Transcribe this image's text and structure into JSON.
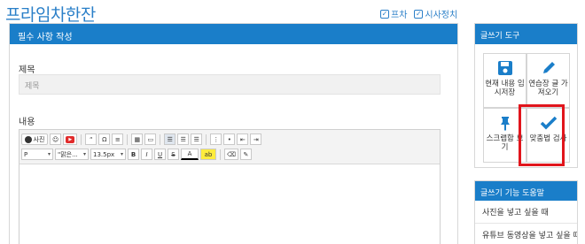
{
  "header": {
    "title": "프라임차한잔",
    "checks": [
      {
        "label": "프차",
        "checked": true
      },
      {
        "label": "시사정치",
        "checked": true
      }
    ]
  },
  "form": {
    "panel_title": "필수 사항 작성",
    "title_label": "제목",
    "title_placeholder": "제목",
    "content_label": "내용"
  },
  "editor": {
    "photo_label": "사진",
    "quote_label": "“",
    "omega_label": "Ω",
    "paragraph_value": "P",
    "font_value": "\"맑은...",
    "size_value": "13.5px",
    "bold": "B",
    "italic": "I",
    "underline": "U",
    "strike": "S",
    "font_color": "A"
  },
  "side": {
    "title": "글쓰기 도구",
    "tools": [
      {
        "label": "현재 내용 임시저장",
        "icon": "save-icon"
      },
      {
        "label": "연습장 글 가져오기",
        "icon": "pencil-icon"
      },
      {
        "label": "스크랩함 보기",
        "icon": "pin-icon"
      },
      {
        "label": "맞춤법 검사",
        "icon": "check-icon"
      }
    ]
  },
  "help": {
    "title": "글쓰기 기능 도움말",
    "items": [
      "사진을 넣고 싶을 때",
      "유튜브 동영상을 넣고 싶을 때"
    ]
  },
  "colors": {
    "accent": "#1a7ec9",
    "highlight": "#e1151c"
  }
}
